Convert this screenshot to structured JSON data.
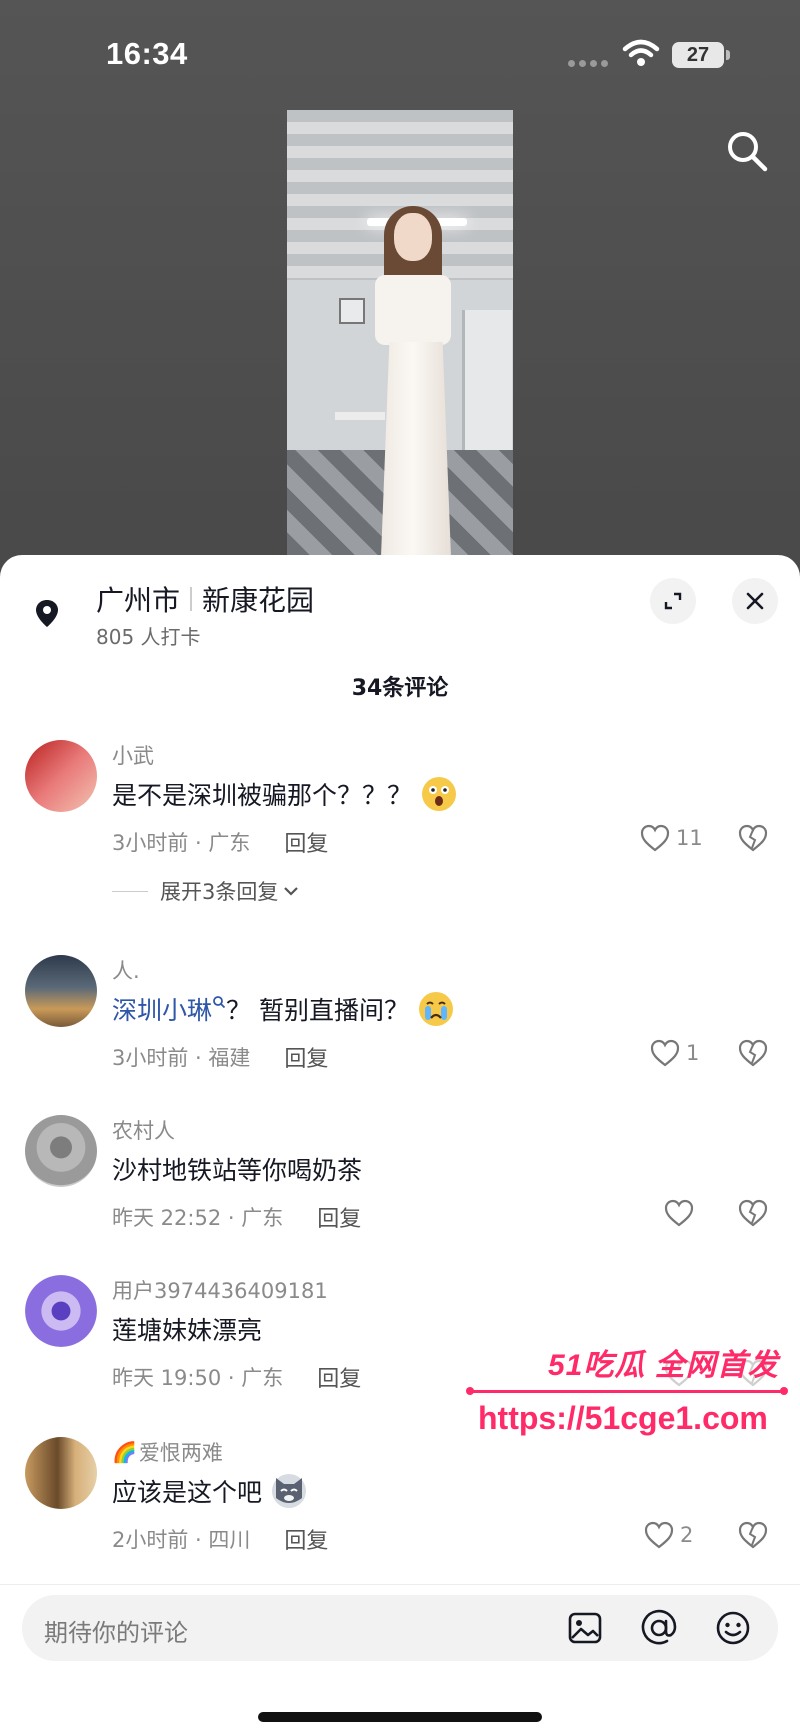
{
  "status_bar": {
    "time": "16:34",
    "battery": "27"
  },
  "location": {
    "city": "广州市",
    "place": "新康花园",
    "checkins": "805 人打卡"
  },
  "comments_header": {
    "count_label": "34条评论"
  },
  "comments": [
    {
      "user": "小武",
      "text": "是不是深圳被骗那个？？？",
      "emoji": "shocked-emoji",
      "time_loc": "3小时前 · 广东",
      "reply": "回复",
      "likes": "11",
      "expand_replies": "展开3条回复"
    },
    {
      "user": "人.",
      "mention": "深圳小琳",
      "text": "？ 暂别直播间？",
      "emoji": "crying-emoji",
      "time_loc": "3小时前 · 福建",
      "reply": "回复",
      "likes": "1"
    },
    {
      "user": "农村人",
      "text": "沙村地铁站等你喝奶茶",
      "time_loc": "昨天 22:52 · 广东",
      "reply": "回复",
      "likes": ""
    },
    {
      "user": "用户3974436409181",
      "text": "莲塘妹妹漂亮",
      "time_loc": "昨天 19:50 · 广东",
      "reply": "回复",
      "likes": ""
    },
    {
      "user": "爱恨两难",
      "user_prefix_emoji": "🌈",
      "text": "应该是这个吧",
      "emoji": "cat-emoji",
      "time_loc": "2小时前 · 四川",
      "reply": "回复",
      "likes": "2"
    }
  ],
  "watermark": {
    "line1": "51吃瓜 全网首发",
    "line2": "https://51cge1.com"
  },
  "input": {
    "placeholder": "期待你的评论"
  },
  "colors": {
    "accent_mention": "#2f57a8",
    "watermark": "#ff2a68",
    "text_primary": "#161823",
    "text_secondary": "#8a8a8a"
  }
}
